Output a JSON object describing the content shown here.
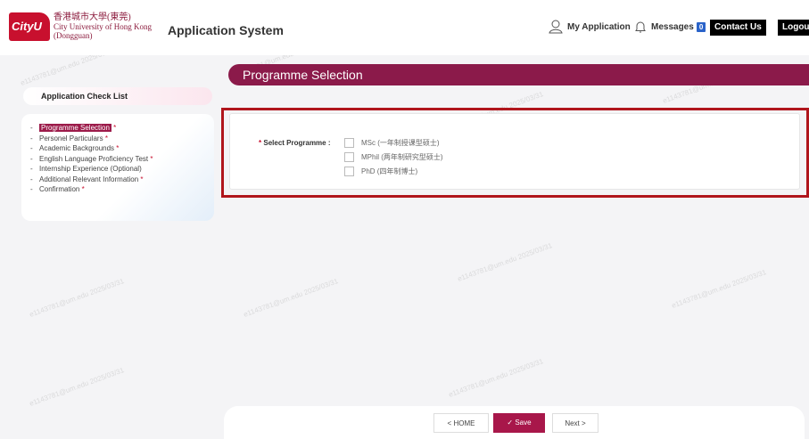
{
  "header": {
    "logo_mark": "CityU",
    "logo_cn": "香港城市大學(東莞)",
    "logo_en": "City University of Hong Kong",
    "logo_sub": "(Dongguan)",
    "app_title": "Application System",
    "my_application": "My Application",
    "messages": "Messages",
    "messages_count": "0",
    "contact_us": "Contact Us",
    "logout": "Logout"
  },
  "sidebar": {
    "title": "Application Check List",
    "items": [
      {
        "label": "Programme Selection",
        "required": "*"
      },
      {
        "label": "Personel Particulars",
        "required": "*"
      },
      {
        "label": "Academic Backgrounds",
        "required": "*"
      },
      {
        "label": "English Language Proficiency Test",
        "required": "*"
      },
      {
        "label": "Internship Experience (Optional)",
        "required": ""
      },
      {
        "label": "Additional Relevant Information",
        "required": "*"
      },
      {
        "label": "Confirmation",
        "required": "*"
      }
    ]
  },
  "main": {
    "title": "Programme Selection",
    "field_label": "Select Programme :",
    "required": "*",
    "options": [
      "MSc (一年制授课型硕士)",
      "MPhil (两年制研究型硕士)",
      "PhD (四年制博士)"
    ]
  },
  "footer": {
    "home": "HOME",
    "save": "Save",
    "next": "Next"
  },
  "watermark": "e1143781@um.edu 2025/03/31",
  "colors": {
    "brand": "#8b1a4a",
    "highlight_frame": "#b0161c",
    "badge": "#2a63c9"
  }
}
